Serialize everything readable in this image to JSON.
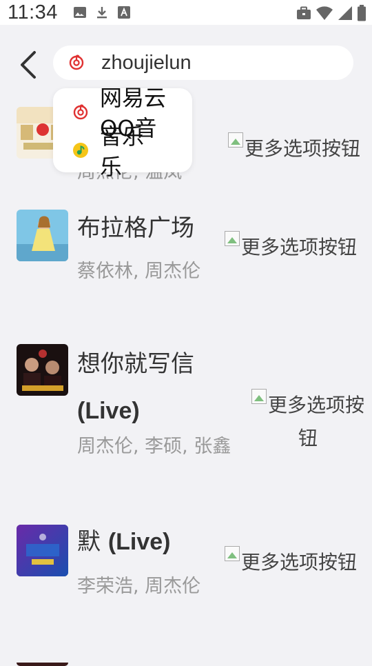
{
  "status_bar": {
    "time": "11:34"
  },
  "search": {
    "value": "zhoujielun"
  },
  "source_menu": {
    "items": [
      {
        "label": "网易云音乐",
        "icon": "netease-music-icon",
        "color": "#e03131"
      },
      {
        "label": "QQ音乐",
        "icon": "qq-music-icon",
        "color": "#f5c518"
      }
    ]
  },
  "results": [
    {
      "title": "",
      "title_live": "",
      "artist": "周杰伦, 温岚",
      "more_label": "更多选项按钮"
    },
    {
      "title": "布拉格广场",
      "title_live": "",
      "artist": "蔡依林, 周杰伦",
      "more_label": "更多选项按钮"
    },
    {
      "title": "想你就写信",
      "title_live": "(Live)",
      "artist": "周杰伦, 李硕, 张鑫",
      "more_label": "更多选项按钮"
    },
    {
      "title": "默",
      "title_live": "(Live)",
      "artist": "李荣浩, 周杰伦",
      "more_label": "更多选项按钮"
    }
  ]
}
